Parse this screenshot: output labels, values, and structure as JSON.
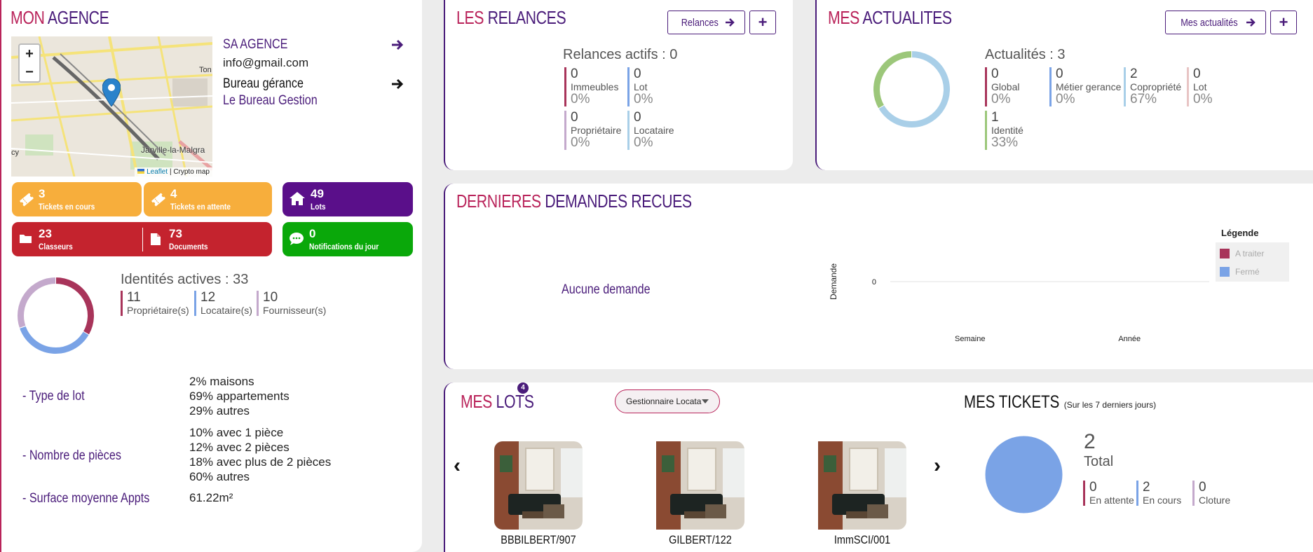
{
  "colors": {
    "accent_pink": "#b9235a",
    "accent_purple": "#4a1c7a",
    "orange": "#f7ae3c",
    "red": "#c4232e",
    "violet": "#5a0f8a",
    "green": "#0aa80a"
  },
  "agence": {
    "title_part1": "MON",
    "title_part2": "AGENCE",
    "name": "SA AGENCE",
    "email": "info@gmail.com",
    "bureau_label": "Bureau gérance",
    "bureau_name": "Le Bureau Gestion",
    "map": {
      "zoom_in": "+",
      "zoom_out": "−",
      "place_label": "Jarville-la-Malgra",
      "edge_label_top": "Ton",
      "edge_label_left": "cy",
      "attribution_link": "Leaflet",
      "attribution_rest": "| Crypto map"
    },
    "tiles": [
      {
        "value": "3",
        "caption": "Tickets en cours",
        "icon": "ticket-icon"
      },
      {
        "value": "4",
        "caption": "Tickets en attente",
        "icon": "ticket-icon"
      },
      {
        "value": "49",
        "caption": "Lots",
        "icon": "home-icon"
      },
      {
        "value": "23",
        "caption": "Classeurs",
        "icon": "folder-icon"
      },
      {
        "value": "73",
        "caption": "Documents",
        "icon": "document-icon"
      },
      {
        "value": "0",
        "caption": "Notifications du jour",
        "icon": "chat-icon"
      }
    ],
    "identites": {
      "title": "Identités actives : 33",
      "items": [
        {
          "value": "11",
          "label": "Propriétaire(s)",
          "color": "#a8345a"
        },
        {
          "value": "12",
          "label": "Locataire(s)",
          "color": "#7aa3e6"
        },
        {
          "value": "10",
          "label": "Fournisseur(s)",
          "color": "#c4a9cc"
        }
      ]
    },
    "details": [
      {
        "label": "- Type de lot",
        "values": [
          "2% maisons",
          "69% appartements",
          "29% autres"
        ]
      },
      {
        "label": "- Nombre de pièces",
        "values": [
          "10% avec 1 pièce",
          "12% avec 2 pièces",
          "18% avec plus de 2 pièces",
          "60% autres"
        ]
      },
      {
        "label": "- Surface moyenne Appts",
        "values": [
          "61.22m²"
        ]
      }
    ]
  },
  "relances": {
    "title_part1": "LES",
    "title_part2": "RELANCES",
    "button_label": "Relances",
    "add_label": "+",
    "summary": "Relances actifs : 0",
    "items": [
      {
        "value": "0",
        "label": "Immeubles",
        "pct": "0%",
        "color": "#a8345a"
      },
      {
        "value": "0",
        "label": "Lot",
        "pct": "0%",
        "color": "#7aa3e6"
      },
      {
        "value": "0",
        "label": "Propriétaire",
        "pct": "0%",
        "color": "#c4a9cc"
      },
      {
        "value": "0",
        "label": "Locataire",
        "pct": "0%",
        "color": "#a9cfe8"
      }
    ]
  },
  "actualites": {
    "title_part1": "MES",
    "title_part2": "ACTUALITES",
    "button_label": "Mes actualités",
    "add_label": "+",
    "summary": "Actualités : 3",
    "items": [
      {
        "value": "0",
        "label": "Global",
        "pct": "0%",
        "color": "#a8345a"
      },
      {
        "value": "0",
        "label": "Métier gerance",
        "pct": "0%",
        "color": "#7aa3e6"
      },
      {
        "value": "2",
        "label": "Copropriété",
        "pct": "67%",
        "color": "#a9cfe8"
      },
      {
        "value": "0",
        "label": "Lot",
        "pct": "0%",
        "color": "#e8c4c4"
      },
      {
        "value": "1",
        "label": "Identité",
        "pct": "33%",
        "color": "#9cc77a"
      }
    ]
  },
  "demandes": {
    "title_part1": "DERNIERES",
    "title_part2": "DEMANDES RECUES",
    "empty_text": "Aucune demande",
    "chart_data": {
      "type": "bar",
      "categories": [
        "Semaine",
        "Année"
      ],
      "series": [
        {
          "name": "A traiter",
          "values": [
            0,
            0
          ],
          "color": "#a8345a"
        },
        {
          "name": "Fermé",
          "values": [
            0,
            0
          ],
          "color": "#7aa3e6"
        }
      ],
      "ylabel": "Demande",
      "y_ticks": [
        "0"
      ],
      "legend_title": "Légende",
      "legend_position": "right"
    }
  },
  "lots": {
    "title_part1": "MES",
    "title_part2": "LOTS",
    "badge": "4",
    "dropdown_value": "Gestionnaire Locata",
    "prev": "‹",
    "next": "›",
    "items": [
      {
        "name": "BBBILBERT/907"
      },
      {
        "name": "GILBERT/122"
      },
      {
        "name": "ImmSCI/001"
      }
    ]
  },
  "tickets": {
    "title": "MES TICKETS",
    "subtitle": "(Sur les 7 derniers jours)",
    "total_value": "2",
    "total_label": "Total",
    "items": [
      {
        "value": "0",
        "label": "En attente",
        "color": "#a8345a"
      },
      {
        "value": "2",
        "label": "En cours",
        "color": "#7aa3e6"
      },
      {
        "value": "0",
        "label": "Cloture",
        "color": "#c4a9cc"
      }
    ]
  }
}
